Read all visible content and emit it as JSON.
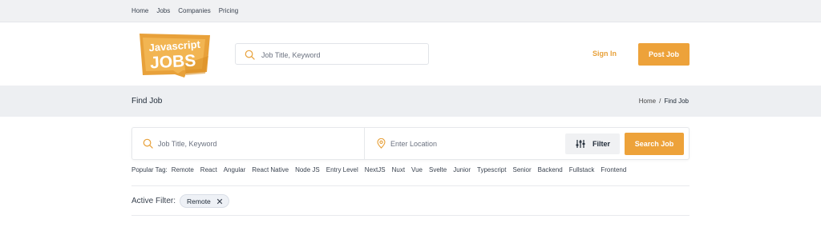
{
  "topnav": {
    "items": [
      "Home",
      "Jobs",
      "Companies",
      "Pricing"
    ]
  },
  "logo": {
    "line1": "Javascript",
    "line2": "JOBS"
  },
  "header": {
    "search_placeholder": "Job Title, Keyword",
    "signin_label": "Sign In",
    "postjob_label": "Post Job"
  },
  "pagebar": {
    "title": "Find Job",
    "breadcrumb": {
      "home": "Home",
      "separator": "/",
      "current": "Find Job"
    }
  },
  "search": {
    "keyword_placeholder": "Job Title, Keyword",
    "location_placeholder": "Enter Location",
    "filter_label": "Filter",
    "search_label": "Search Job"
  },
  "popular": {
    "label": "Popular Tag:",
    "tags": [
      "Remote",
      "React",
      "Angular",
      "React Native",
      "Node JS",
      "Entry Level",
      "NextJS",
      "Nuxt",
      "Vue",
      "Svelte",
      "Junior",
      "Typescript",
      "Senior",
      "Backend",
      "Fullstack",
      "Frontend"
    ]
  },
  "active_filter": {
    "label": "Active Filter:",
    "chips": [
      "Remote"
    ]
  },
  "colors": {
    "accent": "#eda23a",
    "page_bg": "#edeff2",
    "text": "#1f2a37"
  },
  "icons": {
    "search": "search-icon",
    "location": "location-pin-icon",
    "filter": "sliders-icon",
    "remove": "close-icon"
  }
}
